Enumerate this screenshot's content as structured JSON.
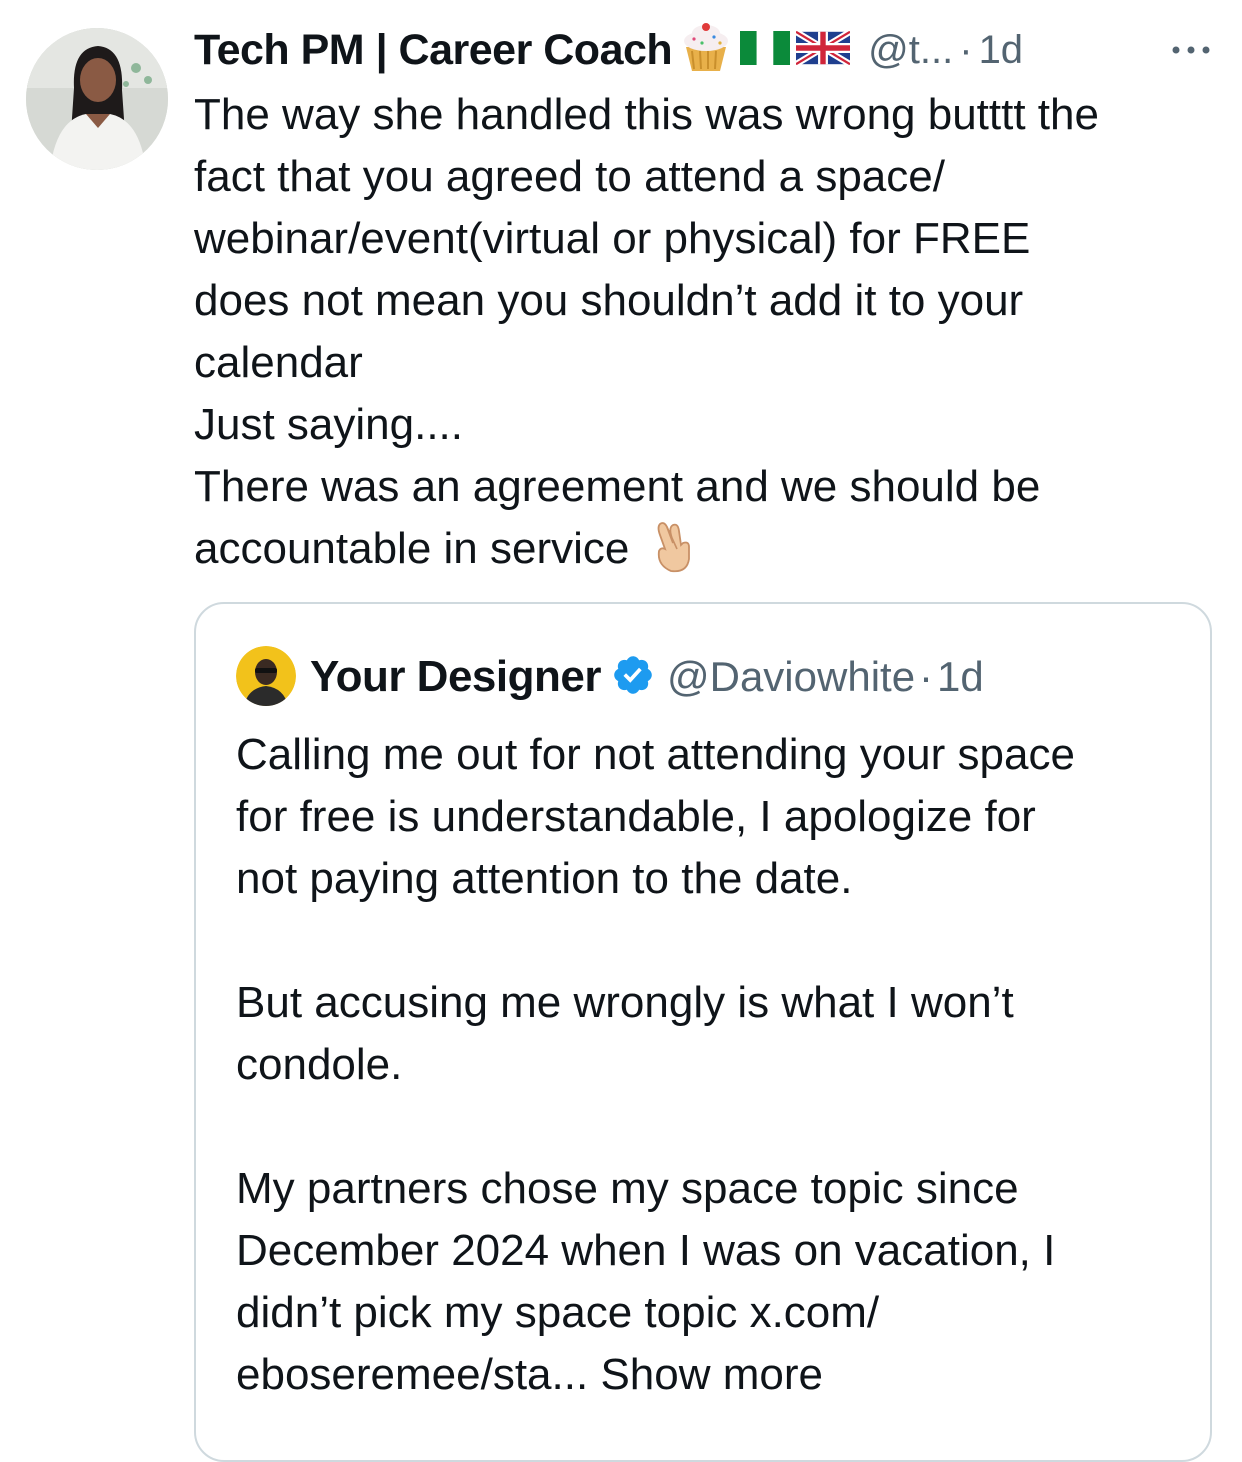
{
  "tweet": {
    "author_name": "Tech PM | Career Coach",
    "handle": "@t...",
    "separator": "·",
    "time": "1d",
    "more_label": "More",
    "emoji_icons": [
      "cupcake-icon",
      "nigeria-flag-icon",
      "uk-flag-icon"
    ],
    "text_lines": [
      "The way she handled this was wrong butttt the",
      "fact that you agreed to attend a space/",
      "webinar/event(virtual or physical) for FREE",
      "does not mean you shouldn’t add it to your",
      "calendar",
      "Just saying....",
      "There was an agreement and we should be",
      "accountable in service"
    ],
    "trailing_emoji": "crossed-fingers-icon"
  },
  "quoted_tweet": {
    "author_name": "Your Designer",
    "handle": "@Daviowhite",
    "separator": "·",
    "time": "1d",
    "verified_icon": "verified-badge-icon",
    "text_lines": [
      "Calling me out for not attending your space",
      "for free is understandable, I apologize for",
      "not paying attention to the date.",
      "",
      "But accusing me wrongly is what I won’t",
      "condole.",
      "",
      "My partners chose my space topic since",
      "December 2024 when I was on vacation, I",
      "didn’t pick my space topic x.com/",
      "eboseremee/sta..."
    ],
    "show_more": "Show more"
  },
  "colors": {
    "text_primary": "#0f1419",
    "text_secondary": "#536471",
    "border": "#cfd9de",
    "verified_blue": "#1d9bf0"
  }
}
